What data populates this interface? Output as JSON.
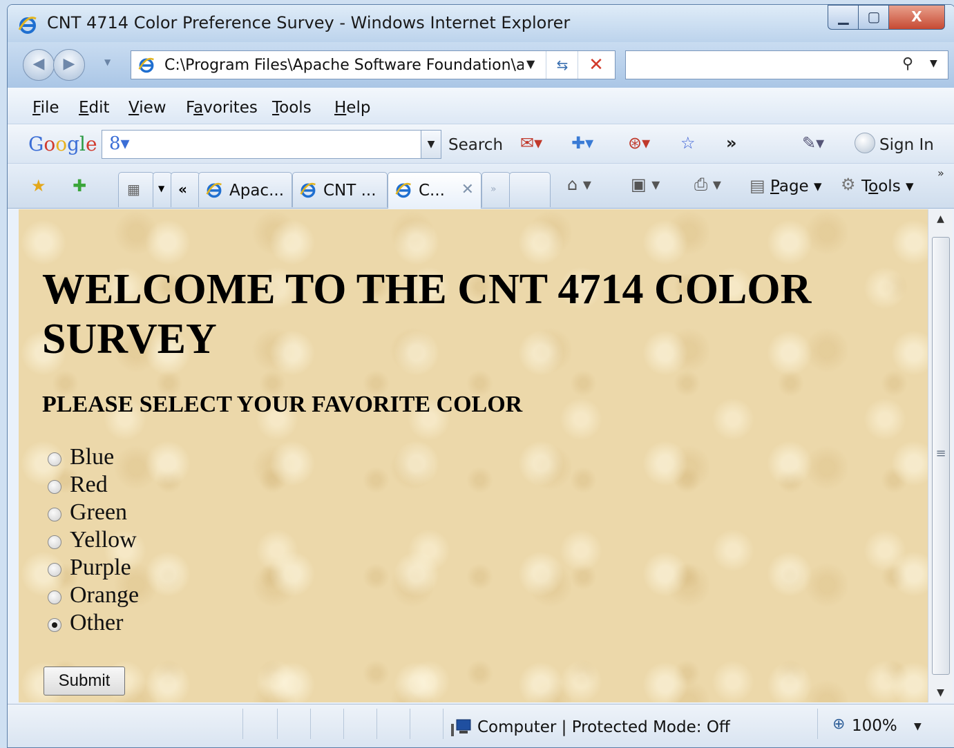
{
  "window": {
    "title": "CNT 4714 Color Preference Survey - Windows Internet Explorer",
    "min_glyph": "▁",
    "max_glyph": "▢",
    "close_glyph": "X"
  },
  "address_bar": {
    "url": "C:\\Program Files\\Apache Software Foundation\\a"
  },
  "search_bar": {
    "value": ""
  },
  "menu": {
    "items": [
      {
        "u": "F",
        "rest": "ile"
      },
      {
        "u": "E",
        "rest": "dit"
      },
      {
        "u": "V",
        "rest": "iew"
      },
      {
        "pre": "F",
        "u": "a",
        "rest": "vorites"
      },
      {
        "u": "T",
        "rest": "ools"
      },
      {
        "u": "H",
        "rest": "elp"
      }
    ]
  },
  "google_toolbar": {
    "search_label": "Search",
    "sign_in_label": "Sign In",
    "more_glyph": "»"
  },
  "tabs": {
    "items": [
      {
        "label": "Apac..."
      },
      {
        "label": "CNT ..."
      },
      {
        "label": "C..."
      }
    ],
    "page_pre": "",
    "page_u": "P",
    "page_rest": "age",
    "tools_pre": "T",
    "tools_u": "o",
    "tools_rest": "ols"
  },
  "page": {
    "heading": "WELCOME TO THE CNT 4714 COLOR SURVEY",
    "subheading": "PLEASE SELECT YOUR FAVORITE COLOR",
    "options": [
      {
        "label": "Blue",
        "checked": false
      },
      {
        "label": "Red",
        "checked": false
      },
      {
        "label": "Green",
        "checked": false
      },
      {
        "label": "Yellow",
        "checked": false
      },
      {
        "label": "Purple",
        "checked": false
      },
      {
        "label": "Orange",
        "checked": false
      },
      {
        "label": "Other",
        "checked": true
      }
    ],
    "submit_label": "Submit"
  },
  "status_bar": {
    "zone": "Computer | Protected Mode: Off",
    "zoom": "100%"
  },
  "colors": {
    "page_background": "#ecd8aa",
    "ie_blue": "#1f6fd0",
    "close_red": "#c74a33"
  }
}
